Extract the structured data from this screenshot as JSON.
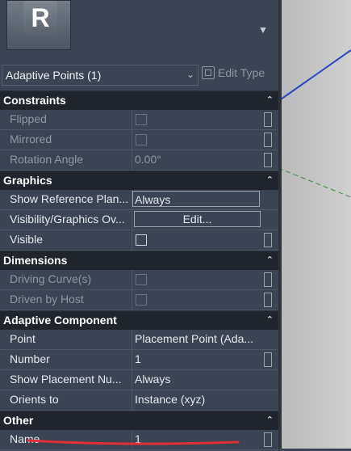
{
  "header": {
    "family_logo_letter": "R",
    "selector_label": "Adaptive Points (1)",
    "edit_type_label": "Edit Type"
  },
  "groups": {
    "constraints": "Constraints",
    "graphics": "Graphics",
    "dimensions": "Dimensions",
    "adaptive_component": "Adaptive Component",
    "other": "Other"
  },
  "rows": {
    "flipped": {
      "label": "Flipped"
    },
    "mirrored": {
      "label": "Mirrored"
    },
    "rotation_angle": {
      "label": "Rotation Angle",
      "value": "0.00°"
    },
    "show_reference_plane": {
      "label": "Show Reference Plan...",
      "value": "Always"
    },
    "visibility_graphics": {
      "label": "Visibility/Graphics Ov...",
      "value": "Edit..."
    },
    "visible": {
      "label": "Visible"
    },
    "driving_curves": {
      "label": "Driving Curve(s)"
    },
    "driven_by_host": {
      "label": "Driven by Host"
    },
    "point": {
      "label": "Point",
      "value": "Placement Point (Ada..."
    },
    "number": {
      "label": "Number",
      "value": "1"
    },
    "show_placement_number": {
      "label": "Show Placement Nu...",
      "value": "Always"
    },
    "orients_to": {
      "label": "Orients to",
      "value": "Instance (xyz)"
    },
    "name": {
      "label": "Name",
      "value": "1"
    }
  },
  "colors": {
    "panel_bg": "#3b4453",
    "group_bg": "#20252d",
    "annotation": "#e0303a",
    "viewport_line_blue": "#2c46c9",
    "viewport_line_green": "#3a8a3a"
  }
}
